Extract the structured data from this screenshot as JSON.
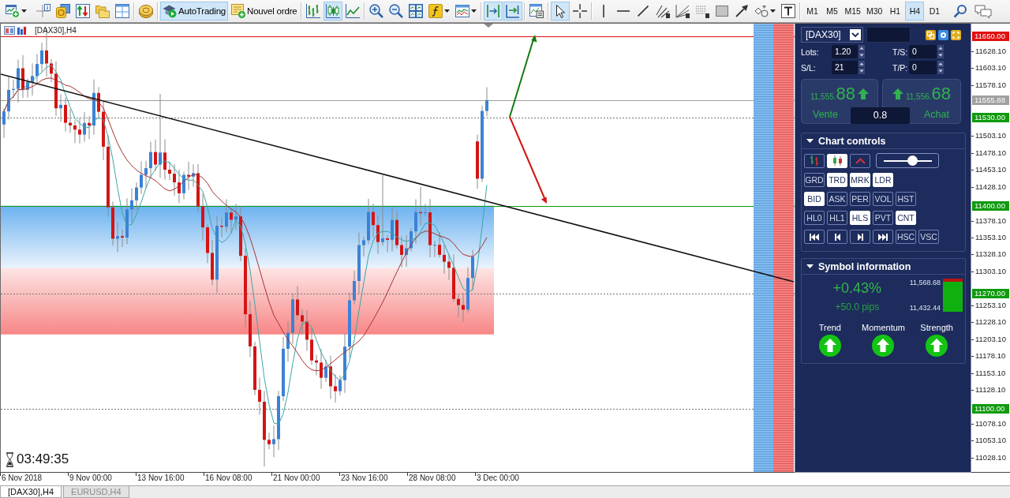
{
  "toolbar": {
    "autotrading": {
      "label": "AutoTrading",
      "on": true
    },
    "new_order": {
      "label": "Nouvel ordre"
    },
    "chart_types": [
      {
        "selected": false
      },
      {
        "selected": true
      },
      {
        "selected": false
      }
    ],
    "chart_shift": {
      "on": true
    },
    "auto_scroll": {
      "on": true
    },
    "pointer_modes": [
      {
        "selected": true
      },
      {
        "selected": false
      }
    ],
    "timeframes": [
      {
        "label": "M1",
        "selected": false
      },
      {
        "label": "M5",
        "selected": false
      },
      {
        "label": "M15",
        "selected": false
      },
      {
        "label": "M30",
        "selected": false
      },
      {
        "label": "H1",
        "selected": false
      },
      {
        "label": "H4",
        "selected": true
      },
      {
        "label": "D1",
        "selected": false
      }
    ]
  },
  "chart": {
    "title": "[DAX30],H4",
    "timer": "03:49:35",
    "price_labels": [
      "11628.10",
      "11603.10",
      "11578.10",
      "11503.10",
      "11478.10",
      "11453.10",
      "11428.10",
      "11378.10",
      "11353.10",
      "11328.10",
      "11303.10",
      "11253.10",
      "11228.10",
      "11203.10",
      "11178.10",
      "11153.10",
      "11128.10",
      "11078.10",
      "11053.10",
      "11028.10"
    ],
    "price_markers": [
      {
        "value": "11650.00",
        "color": "#e01010",
        "kind": "solid"
      },
      {
        "value": "11555.88",
        "color": "#a0a0a0",
        "kind": "solid"
      },
      {
        "value": "11530.00",
        "color": "#0f9a0f",
        "kind": "dotted"
      },
      {
        "value": "11400.00",
        "color": "#0f9a0f",
        "kind": "solid"
      },
      {
        "value": "11270.00",
        "color": "#0f9a0f",
        "kind": "dotted"
      },
      {
        "value": "11100.00",
        "color": "#0f9a0f",
        "kind": "dotted"
      }
    ],
    "time_labels": [
      "6 Nov 2018",
      "9 Nov 00:00",
      "13 Nov 16:00",
      "16 Nov 08:00",
      "21 Nov 00:00",
      "23 Nov 16:00",
      "28 Nov 08:00",
      "3 Dec 00:00"
    ]
  },
  "panel": {
    "symbol": "[DAX30]",
    "fields": [
      {
        "label": "Lots:",
        "value": "1.20"
      },
      {
        "label": "T/S:",
        "value": "0"
      },
      {
        "label": "S/L:",
        "value": "21"
      },
      {
        "label": "T/P:",
        "value": "0"
      }
    ],
    "sell": {
      "price": "11,555.",
      "pips": "88",
      "label": "Vente",
      "up": true
    },
    "buy": {
      "price": "11,556.",
      "pips": "68",
      "label": "Achat",
      "up": true
    },
    "spread": "0.8",
    "chart_controls": {
      "title": "Chart controls",
      "expanded": true,
      "chart_types": [
        {
          "selected": false
        },
        {
          "selected": true
        },
        {
          "selected": false
        }
      ],
      "zoom": {
        "level": 0.6
      },
      "toggle_rows": [
        [
          {
            "label": "GRD",
            "on": false
          },
          {
            "label": "TRD",
            "on": true
          },
          {
            "label": "MRK",
            "on": true
          },
          {
            "label": "LDR",
            "on": true
          }
        ],
        [
          {
            "label": "BID",
            "on": true
          },
          {
            "label": "ASK",
            "on": false
          },
          {
            "label": "PER",
            "on": false
          },
          {
            "label": "VOL",
            "on": false
          },
          {
            "label": "HST",
            "on": false
          }
        ],
        [
          {
            "label": "HL0",
            "on": false
          },
          {
            "label": "HL1",
            "on": false
          },
          {
            "label": "HLS",
            "on": true
          },
          {
            "label": "PVT",
            "on": false
          },
          {
            "label": "CNT",
            "on": true
          }
        ]
      ],
      "scale_buttons": [
        {
          "label": "HSC",
          "on": false
        },
        {
          "label": "VSC",
          "on": false
        }
      ]
    },
    "symbol_info": {
      "title": "Symbol information",
      "expanded": true,
      "change": "+0.43%",
      "pips": "+50.0 pips",
      "high": "11,568.68",
      "low": "11,432.44",
      "range": {
        "level": 0.9
      },
      "indicators": [
        {
          "label": "Trend",
          "up": true
        },
        {
          "label": "Momentum",
          "up": true
        },
        {
          "label": "Strength",
          "up": true
        }
      ]
    }
  },
  "tabs": [
    {
      "label": "[DAX30],H4",
      "selected": true
    },
    {
      "label": "EURUSD,H4",
      "selected": false
    }
  ]
}
